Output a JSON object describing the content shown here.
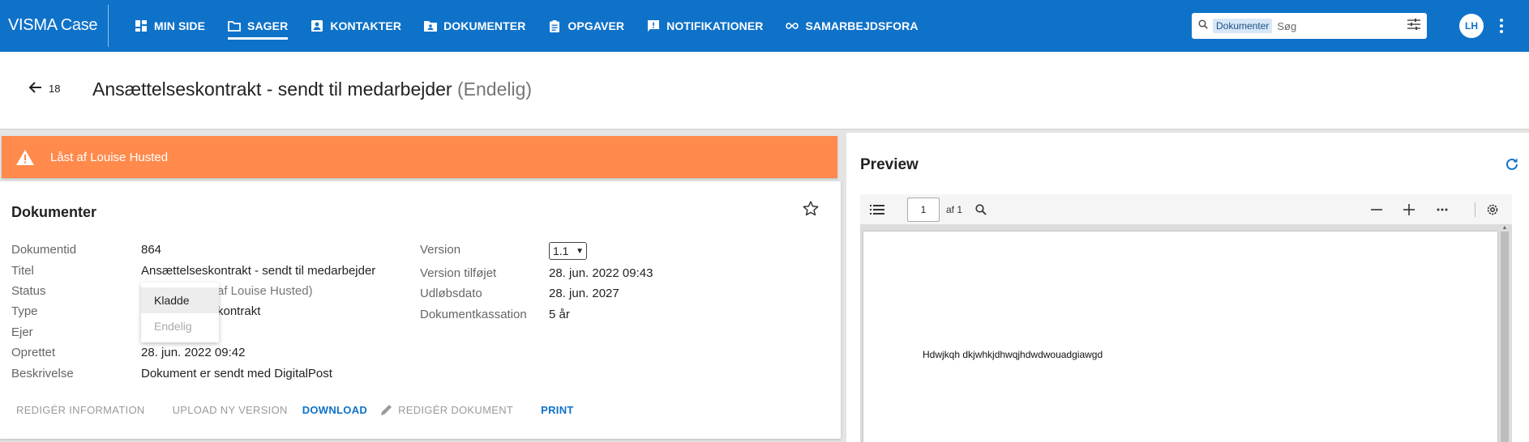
{
  "brand": {
    "name_bold": "VISMA",
    "name_light": "Case"
  },
  "nav": {
    "items": [
      {
        "label": "MIN SIDE",
        "icon": "dashboard-icon",
        "active": false
      },
      {
        "label": "SAGER",
        "icon": "folder-icon",
        "active": true
      },
      {
        "label": "KONTAKTER",
        "icon": "contact-icon",
        "active": false
      },
      {
        "label": "DOKUMENTER",
        "icon": "document-folder-icon",
        "active": false
      },
      {
        "label": "OPGAVER",
        "icon": "clipboard-icon",
        "active": false
      },
      {
        "label": "NOTIFIKATIONER",
        "icon": "notification-icon",
        "active": false
      },
      {
        "label": "SAMARBEJDSFORA",
        "icon": "infinity-icon",
        "active": false
      }
    ]
  },
  "search": {
    "scope_chip": "Dokumenter",
    "placeholder": "Søg"
  },
  "user": {
    "initials": "LH"
  },
  "header": {
    "back_count": "18",
    "title": "Ansættelseskontrakt - sendt til medarbejder",
    "status": "(Endelig)"
  },
  "lock_banner": {
    "text": "Låst af Louise Husted"
  },
  "card": {
    "title": "Dokumenter",
    "fields_left": [
      {
        "label": "Dokumentid",
        "value": "864"
      },
      {
        "label": "Titel",
        "value": "Ansættelseskontrakt - sendt til medarbejder"
      },
      {
        "label": "Status",
        "value": "af Louise Husted)"
      },
      {
        "label": "Type",
        "value": "kontrakt"
      },
      {
        "label": "Ejer",
        "value": ""
      },
      {
        "label": "Oprettet",
        "value": "28. jun. 2022 09:42"
      },
      {
        "label": "Beskrivelse",
        "value": "Dokument er sendt med DigitalPost"
      }
    ],
    "fields_right": [
      {
        "label": "Version",
        "value": "1.1"
      },
      {
        "label": "Version tilføjet",
        "value": "28. jun. 2022 09:43"
      },
      {
        "label": "Udløbsdato",
        "value": "28. jun. 2027"
      },
      {
        "label": "Dokumentkassation",
        "value": "5 år"
      }
    ],
    "status_dropdown": {
      "options": [
        "Kladde",
        "Endelig"
      ],
      "highlighted": "Kladde",
      "disabled": "Endelig"
    },
    "actions": {
      "edit_info": "REDIGÉR INFORMATION",
      "upload_version": "UPLOAD NY VERSION",
      "download": "DOWNLOAD",
      "edit_document": "REDIGÉR DOKUMENT",
      "print": "PRINT"
    }
  },
  "preview": {
    "title": "Preview",
    "page_number": "1",
    "page_total_text": "af 1",
    "document_text": "Hdwjkqh dkjwhkjdhwqjhdwdwouadgiawgd"
  },
  "colors": {
    "primary": "#0f72c9",
    "warning": "#ff8a4c"
  }
}
